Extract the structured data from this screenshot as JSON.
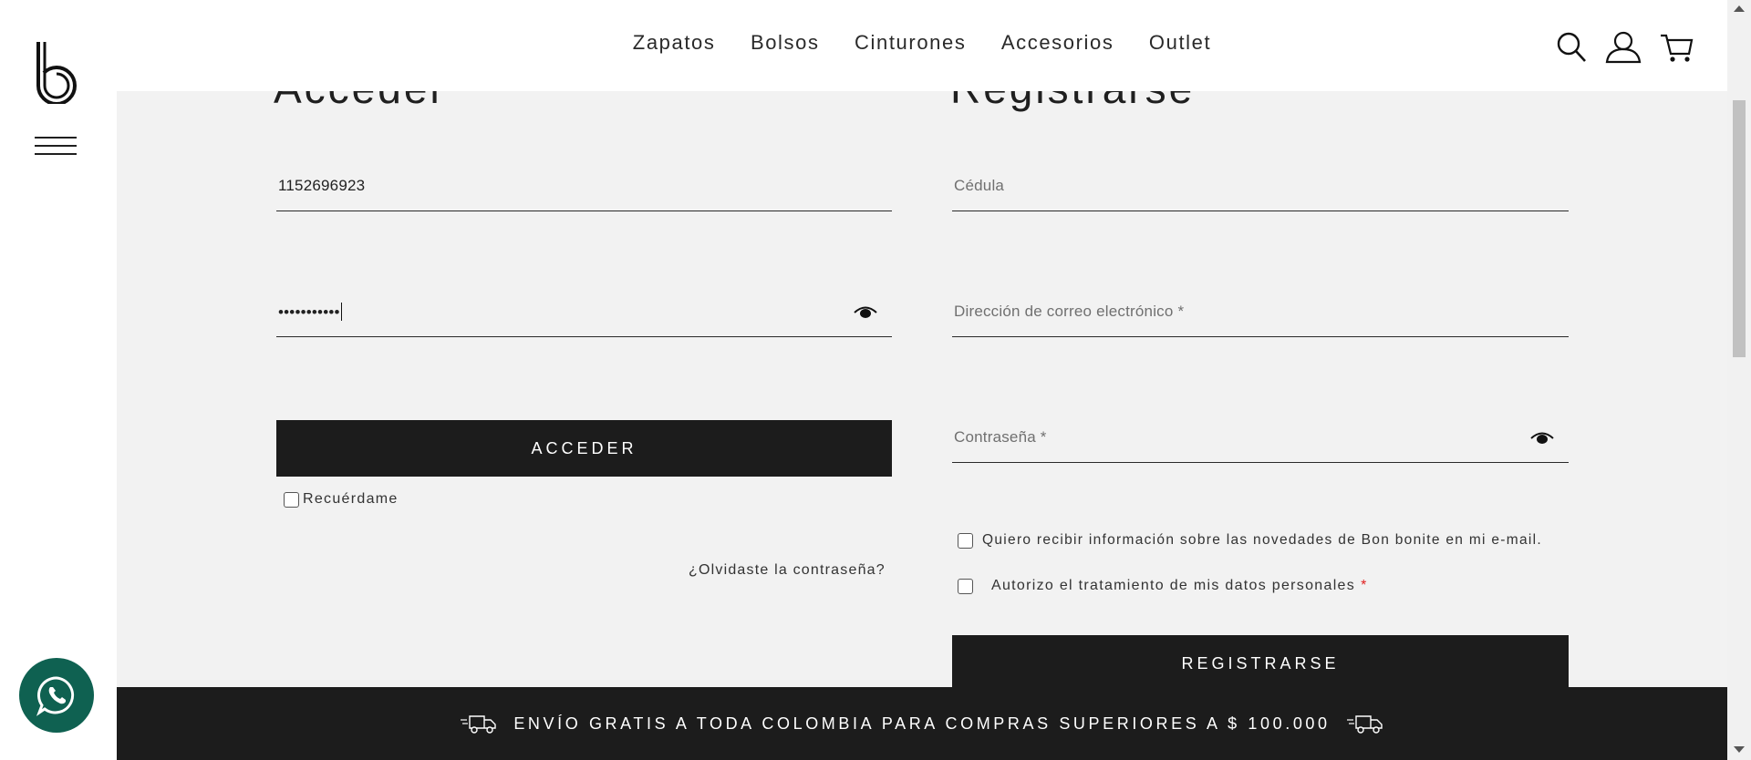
{
  "nav": {
    "items": [
      "Zapatos",
      "Bolsos",
      "Cinturones",
      "Accesorios",
      "Outlet"
    ]
  },
  "icons": {
    "logo": "bon-bonite-logo",
    "menu": "hamburger-icon",
    "search": "search-icon",
    "account": "user-icon",
    "cart": "cart-icon",
    "password_toggle": "eye-icon",
    "whatsapp": "whatsapp-icon",
    "truck": "delivery-truck-icon"
  },
  "login": {
    "title": "Acceder",
    "username_value": "1152696923",
    "password_value": "•••••••••••",
    "submit_label": "ACCEDER",
    "remember_label": "Recuérdame",
    "forgot_label": "¿Olvidaste la contraseña?"
  },
  "register": {
    "title": "Registrarse",
    "cedula_placeholder": "Cédula",
    "email_placeholder": "Dirección de correo electrónico *",
    "password_placeholder": "Contraseña *",
    "newsletter_label": "Quiero recibir información sobre las novedades de Bon bonite en mi e-mail.",
    "privacy_label": "Autorizo el tratamiento de mis datos personales",
    "required_mark": "*",
    "submit_label": "REGISTRARSE"
  },
  "banner": {
    "text": "ENVÍO GRATIS A TODA COLOMBIA PARA COMPRAS SUPERIORES A $ 100.000"
  },
  "colors": {
    "dark": "#1c1c1c",
    "background": "#f2f2f2",
    "whatsapp": "#0f6151",
    "required": "#e02020"
  }
}
